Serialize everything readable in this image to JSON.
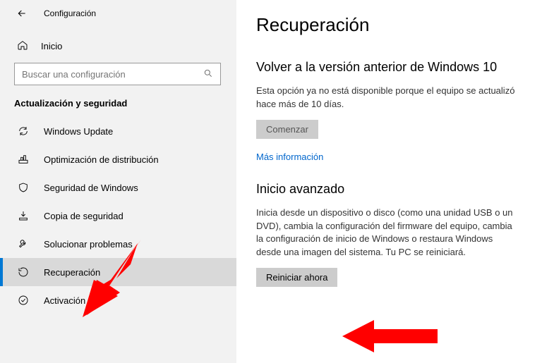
{
  "topbar": {
    "title": "Configuración"
  },
  "home": {
    "label": "Inicio"
  },
  "search": {
    "placeholder": "Buscar una configuración"
  },
  "section_label": "Actualización y seguridad",
  "nav": {
    "items": [
      {
        "label": "Windows Update"
      },
      {
        "label": "Optimización de distribución"
      },
      {
        "label": "Seguridad de Windows"
      },
      {
        "label": "Copia de seguridad"
      },
      {
        "label": "Solucionar problemas"
      },
      {
        "label": "Recuperación"
      },
      {
        "label": "Activación"
      }
    ]
  },
  "page": {
    "heading": "Recuperación",
    "rollback": {
      "title": "Volver a la versión anterior de Windows 10",
      "body": "Esta opción ya no está disponible porque el equipo se actualizó hace más de 10 días.",
      "button": "Comenzar",
      "link": "Más información"
    },
    "advanced": {
      "title": "Inicio avanzado",
      "body": "Inicia desde un dispositivo o disco (como una unidad USB o un DVD), cambia la configuración del firmware del equipo, cambia la configuración de inicio de Windows o restaura Windows desde una imagen del sistema. Tu PC se reiniciará.",
      "button": "Reiniciar ahora"
    }
  },
  "annotation_color": "#ff0000"
}
